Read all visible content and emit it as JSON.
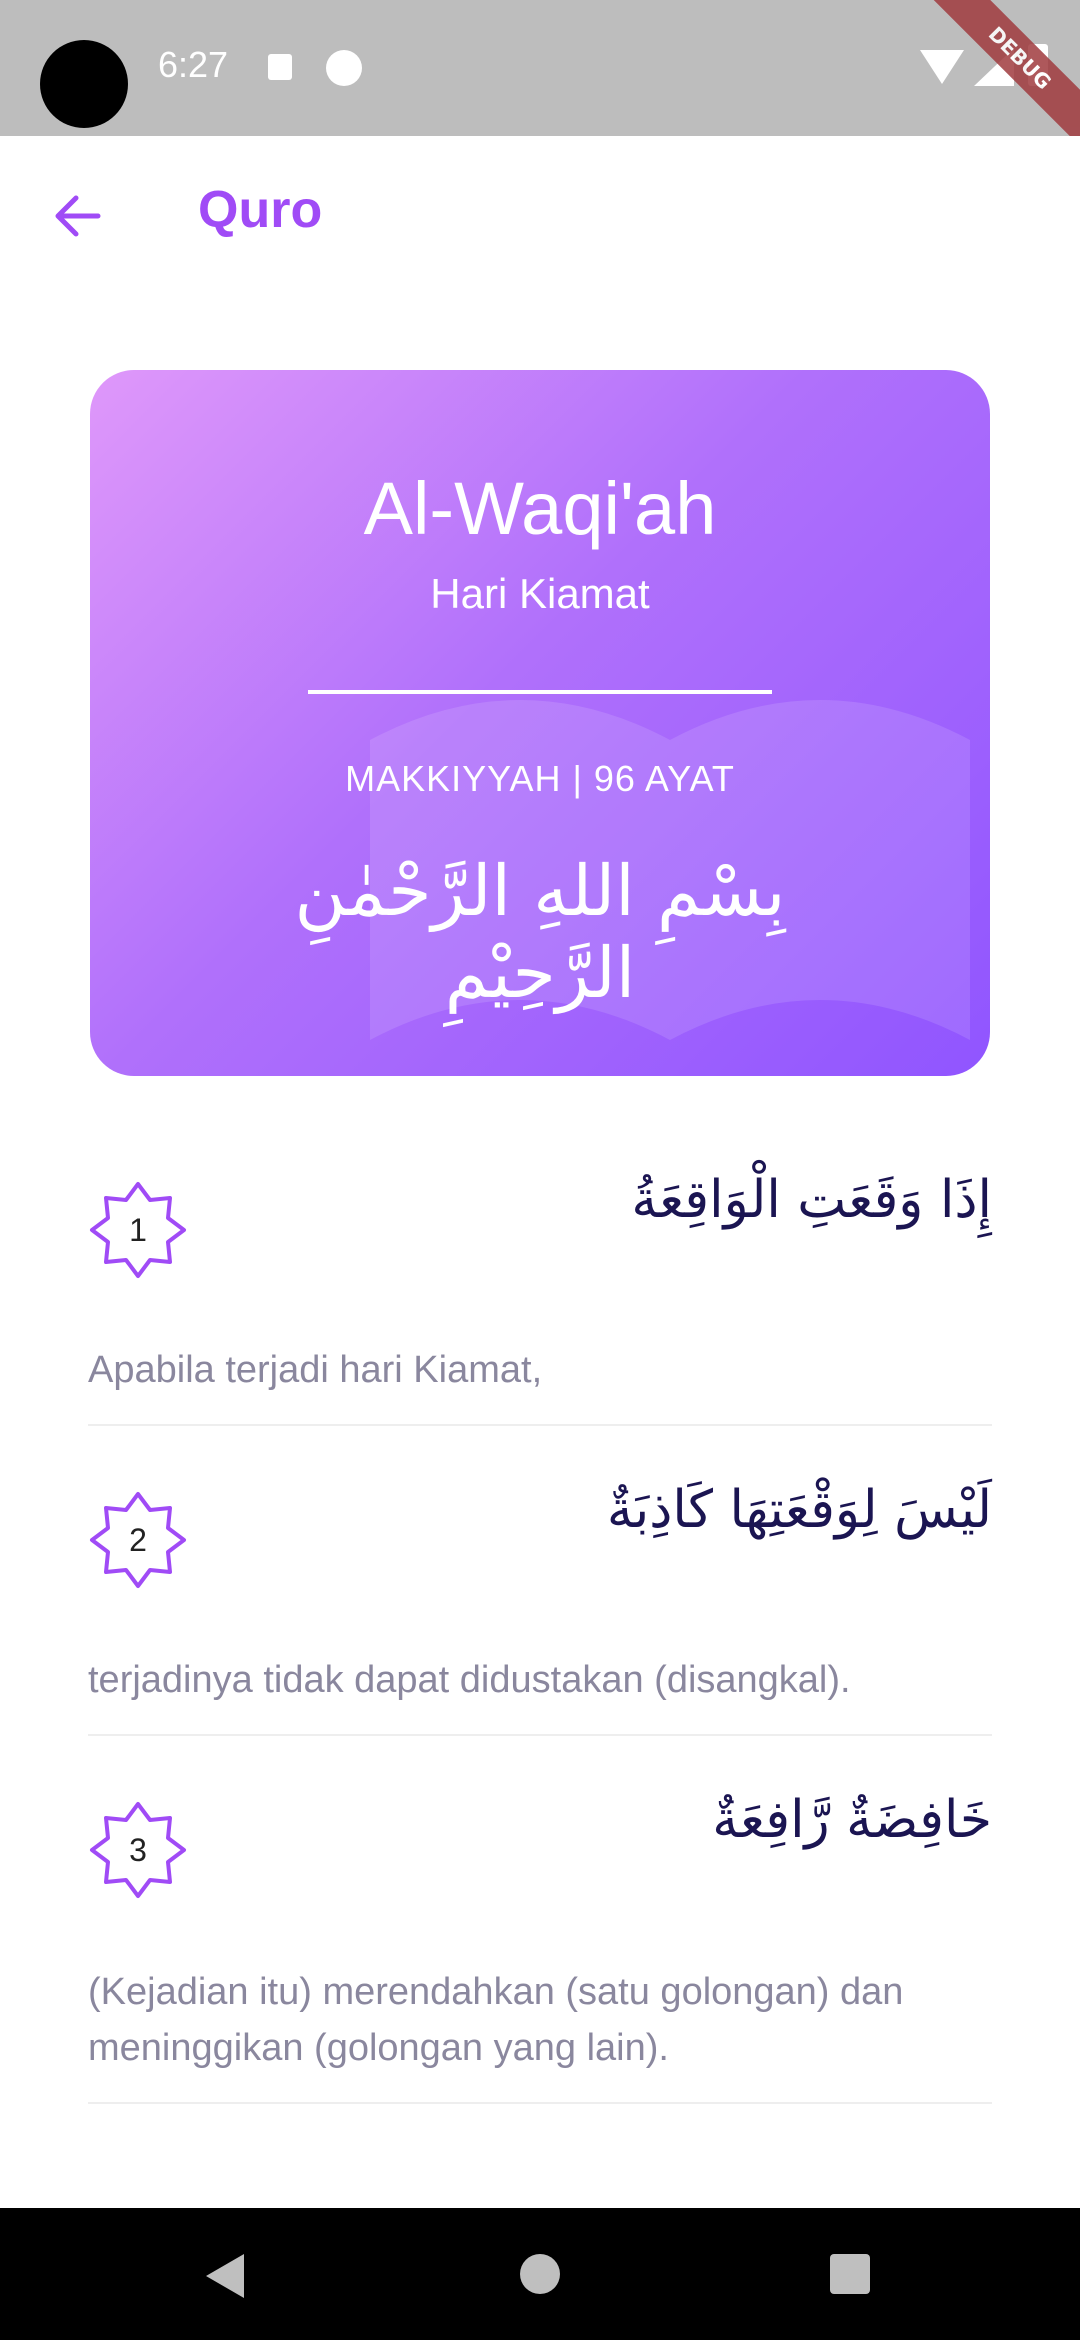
{
  "status_bar": {
    "time": "6:27",
    "debug_banner": "DEBUG"
  },
  "app_bar": {
    "title": "Quro",
    "back_icon": "arrow-left-icon"
  },
  "surah_card": {
    "name": "Al-Waqi'ah",
    "meaning": "Hari Kiamat",
    "meta": "MAKKIYYAH | 96 AYAT",
    "bismillah": "بِسْمِ اللهِ الرَّحْمٰنِ الرَّحِيْمِ"
  },
  "ayat": [
    {
      "number": "1",
      "arabic": "إِذَا وَقَعَتِ الْوَاقِعَةُ",
      "translation": "Apabila terjadi hari Kiamat,"
    },
    {
      "number": "2",
      "arabic": "لَيْسَ لِوَقْعَتِهَا كَاذِبَةٌ",
      "translation": "terjadinya tidak dapat didustakan (disangkal)."
    },
    {
      "number": "3",
      "arabic": "خَافِضَةٌ رَّافِعَةٌ",
      "translation": "(Kejadian itu) merendahkan (satu golongan) dan meninggikan (golongan yang lain)."
    }
  ],
  "colors": {
    "accent": "#a04bf6",
    "arabic_text": "#1b1552",
    "translation_text": "#8a879e"
  }
}
